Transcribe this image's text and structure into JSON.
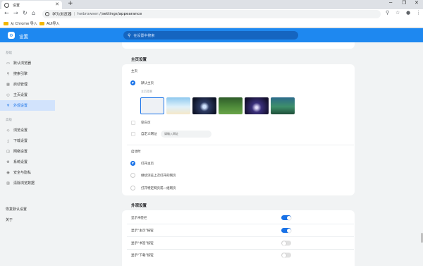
{
  "browser": {
    "tab_title": "设置",
    "new_tab": "+",
    "url_site": "学为浏览器",
    "url_host": "hwbrowser://",
    "url_path": "settings/appearance",
    "bookmarks": [
      "从 Chrome 导入",
      "AUI导入"
    ]
  },
  "app": {
    "title": "设置",
    "search_placeholder": "在设置中搜索"
  },
  "sidebar": {
    "group1": "基础",
    "items1": [
      {
        "label": "默认浏览器",
        "icon": "browser-icon"
      },
      {
        "label": "搜索引擎",
        "icon": "search-icon"
      },
      {
        "label": "启动管理",
        "icon": "grid-icon"
      },
      {
        "label": "主页设置",
        "icon": "home-icon"
      },
      {
        "label": "外观设置",
        "icon": "palette-icon"
      }
    ],
    "group2": "高级",
    "items2": [
      {
        "label": "浏览设置",
        "icon": "shield-icon"
      },
      {
        "label": "下载设置",
        "icon": "download-icon"
      },
      {
        "label": "网络设置",
        "icon": "network-icon"
      },
      {
        "label": "系统设置",
        "icon": "gear-icon"
      },
      {
        "label": "安全与隐私",
        "icon": "lock-icon"
      },
      {
        "label": "清除浏览数据",
        "icon": "trash-icon"
      }
    ],
    "bottom": [
      "恢复默认设置",
      "关于"
    ]
  },
  "homepage": {
    "section_title": "主页设置",
    "label_home": "主页",
    "opt_default": "默认主页",
    "sub_background": "主页背景",
    "opt_blank": "空白页",
    "opt_custom": "自定义网址",
    "url_placeholder": "请输入网址",
    "label_startup": "启动时",
    "startup_opts": [
      "打开主页",
      "继续浏览上次打开的网页",
      "打开特定网页或一组网页"
    ]
  },
  "appearance": {
    "section_title": "外观设置",
    "rows": [
      {
        "label": "显示书签栏",
        "on": true
      },
      {
        "label": "显示“主页”按钮",
        "on": true
      },
      {
        "label": "显示“书签”按钮",
        "on": false
      },
      {
        "label": "显示“下载”按钮",
        "on": false
      }
    ]
  },
  "colors": {
    "accent": "#1a73e8",
    "header": "#1e88f0"
  }
}
